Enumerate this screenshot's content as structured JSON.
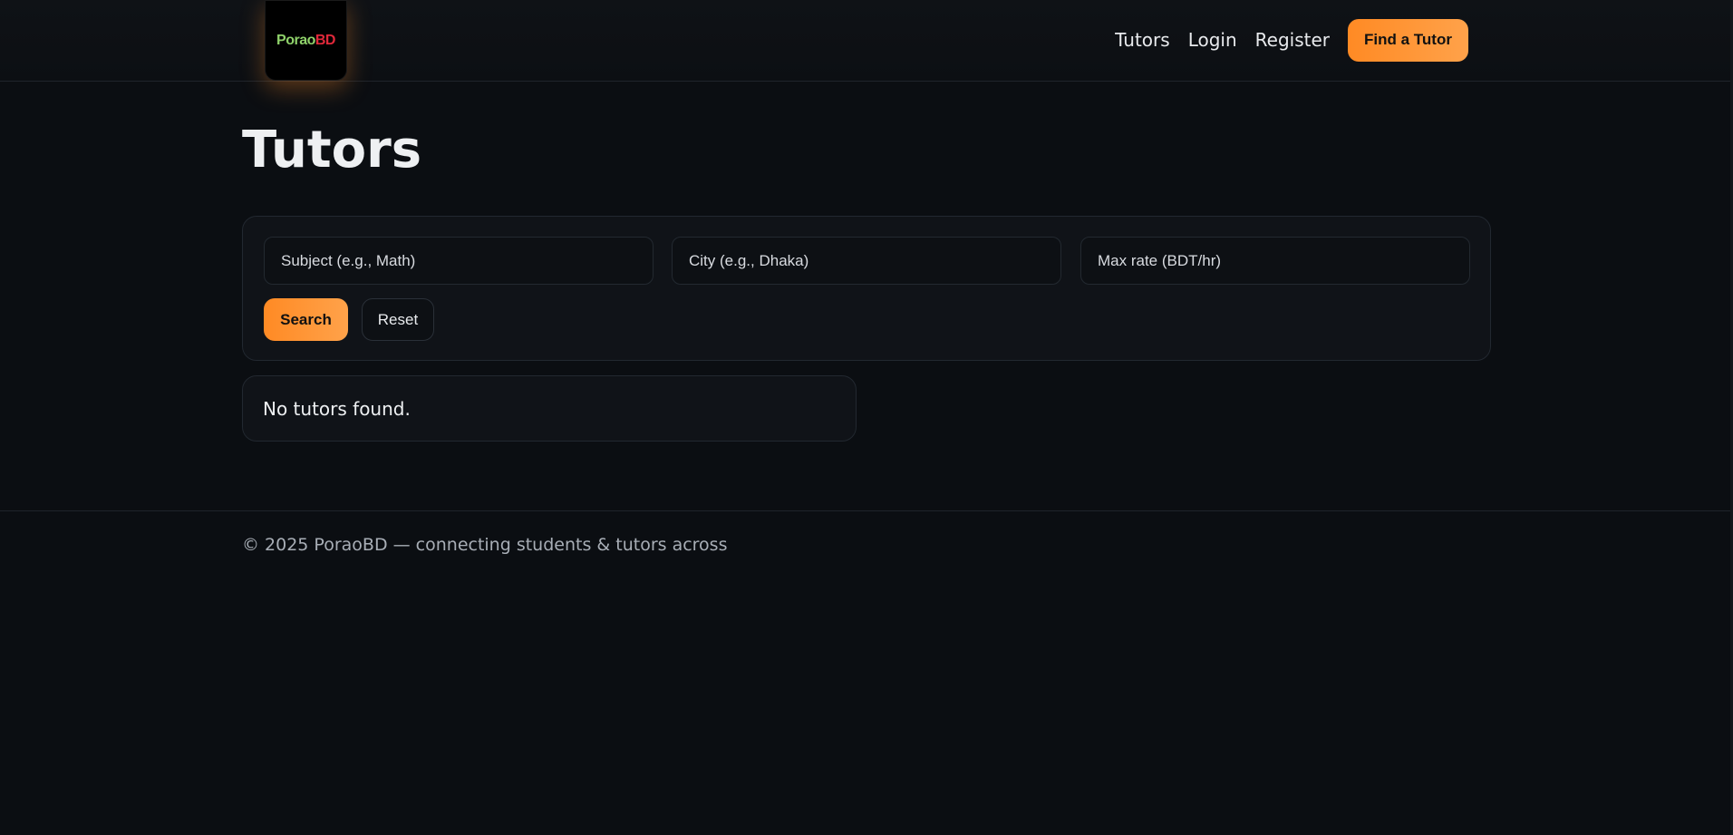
{
  "header": {
    "logo": {
      "text_part1": "Porao",
      "text_part2": "BD"
    },
    "nav": [
      {
        "label": "Tutors"
      },
      {
        "label": "Login"
      },
      {
        "label": "Register"
      }
    ],
    "cta_label": "Find a Tutor",
    "colors": {
      "accent": "#ff8a24",
      "accent_light": "#ffa24a"
    }
  },
  "page_title": "Tutors",
  "search": {
    "subject_placeholder": "Subject (e.g., Math)",
    "city_placeholder": "City (e.g., Dhaka)",
    "rate_placeholder": "Max rate (BDT/hr)",
    "subject_value": "",
    "city_value": "",
    "rate_value": "",
    "search_label": "Search",
    "reset_label": "Reset"
  },
  "results": {
    "empty_message": "No tutors found."
  },
  "footer": {
    "text": "© 2025 PoraoBD — connecting students & tutors across"
  }
}
